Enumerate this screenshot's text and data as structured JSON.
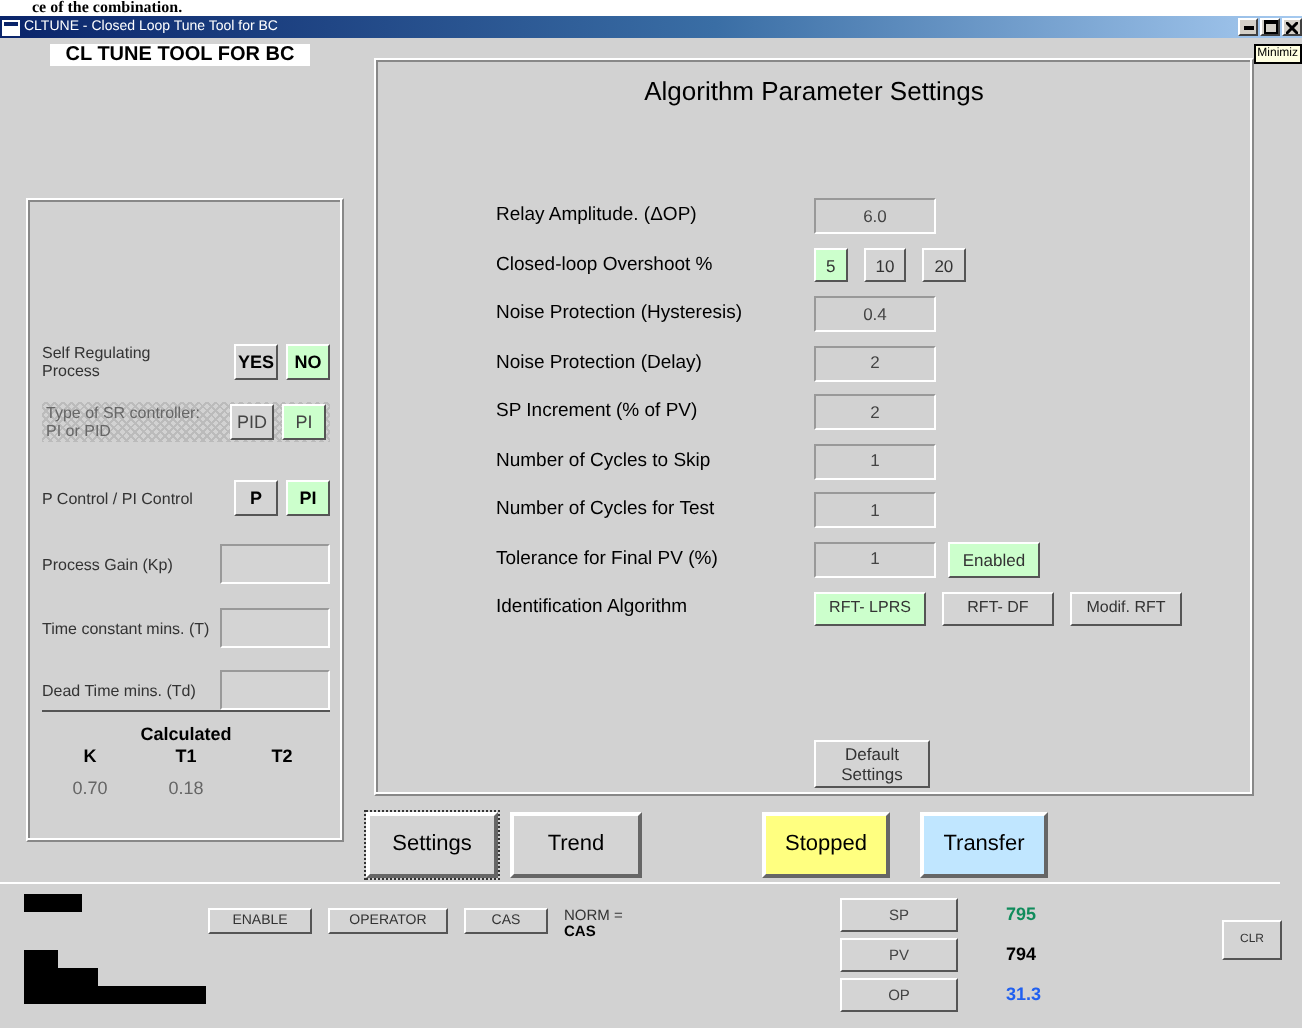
{
  "caption_fragment": "ce of the combination.",
  "window": {
    "title": "CLTUNE - Closed Loop Tune Tool for BC",
    "tooltip": "Minimiz"
  },
  "app_title": "CL TUNE TOOL FOR BC",
  "model_panel": {
    "rows": [
      {
        "kind": "choice",
        "label": "Self Regulating Process",
        "disabled": false,
        "options": [
          {
            "label": "YES",
            "selected": false
          },
          {
            "label": "NO",
            "selected": true
          }
        ]
      },
      {
        "kind": "choice",
        "label": "Type of SR controller: PI or PID",
        "disabled": true,
        "options": [
          {
            "label": "PID",
            "selected": false
          },
          {
            "label": "PI",
            "selected": true
          }
        ]
      },
      {
        "kind": "choice",
        "label": "P Control  /  PI Control",
        "disabled": false,
        "options": [
          {
            "label": "P",
            "selected": false
          },
          {
            "label": "PI",
            "selected": true
          }
        ]
      },
      {
        "kind": "field",
        "label": "Process Gain (Kp)"
      },
      {
        "kind": "field",
        "label": "Time constant mins. (T)"
      },
      {
        "kind": "field",
        "label": "Dead Time mins. (Td)"
      }
    ],
    "calculated": {
      "heading": "Calculated",
      "columns": [
        {
          "name": "K",
          "value": "0.70"
        },
        {
          "name": "T1",
          "value": "0.18"
        },
        {
          "name": "T2"
        }
      ]
    }
  },
  "settings_panel": {
    "title": "Algorithm Parameter Settings",
    "rows": [
      {
        "kind": "field",
        "label": "Relay Amplitude. (ΔOP)",
        "value": "6.0"
      },
      {
        "kind": "options",
        "label": "Closed-loop Overshoot %",
        "options": [
          {
            "label": "5",
            "selected": true
          },
          {
            "label": "10",
            "selected": false
          },
          {
            "label": "20",
            "selected": false
          }
        ]
      },
      {
        "kind": "field",
        "label": "Noise Protection (Hysteresis)",
        "value": "0.4"
      },
      {
        "kind": "field",
        "label": "Noise Protection (Delay)",
        "value": "2"
      },
      {
        "kind": "field",
        "label": "SP Increment (% of PV)",
        "value": "2"
      },
      {
        "kind": "field",
        "label": "Number of Cycles to Skip",
        "value": "1"
      },
      {
        "kind": "field",
        "label": "Number of Cycles for Test",
        "value": "1"
      },
      {
        "kind": "field",
        "label": "Tolerance for Final PV (%)",
        "value": "1",
        "toggle": {
          "label": "Enabled",
          "on": true
        }
      },
      {
        "kind": "options",
        "label": "Identification Algorithm",
        "options": [
          {
            "label": "RFT- LPRS",
            "selected": true
          },
          {
            "label": "RFT- DF",
            "selected": false
          },
          {
            "label": "Modif. RFT",
            "selected": false
          }
        ]
      }
    ],
    "default_button": "Default Settings"
  },
  "tabs": [
    {
      "label": "Settings",
      "selected": true
    },
    {
      "label": "Trend",
      "selected": false
    }
  ],
  "status_buttons": [
    {
      "label": "Stopped",
      "color": "#ffff80"
    },
    {
      "label": "Transfer",
      "color": "#c0e6ff"
    }
  ],
  "mode_buttons": [
    "ENABLE",
    "OPERATOR",
    "CAS"
  ],
  "norm": {
    "label": "NORM =",
    "value": "CAS"
  },
  "process_values": [
    {
      "label": "SP",
      "value": "795",
      "color": "#108c5c"
    },
    {
      "label": "PV",
      "value": "794",
      "color": "#000000"
    },
    {
      "label": "OP",
      "value": "31.3",
      "color": "#2060f0"
    }
  ],
  "clear_button": "CLR"
}
